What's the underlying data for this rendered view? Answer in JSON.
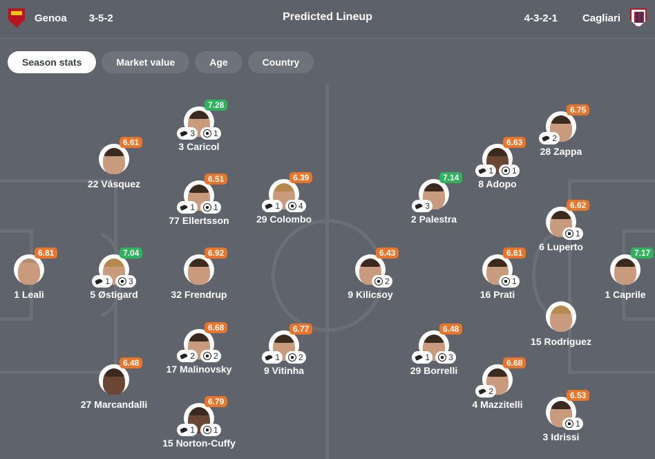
{
  "header": {
    "home": {
      "name": "Genoa",
      "formation": "3-5-2"
    },
    "title": "Predicted Lineup",
    "away": {
      "name": "Cagliari",
      "formation": "4-3-2-1"
    }
  },
  "tabs": [
    {
      "label": "Season stats",
      "active": true
    },
    {
      "label": "Market value",
      "active": false
    },
    {
      "label": "Age",
      "active": false
    },
    {
      "label": "Country",
      "active": false
    }
  ],
  "colors": {
    "rating_orange": "#e8752a",
    "rating_green": "#2fb35c",
    "pitch": "#5f646c",
    "line": "#6b7078"
  },
  "players": {
    "leali": {
      "name": "1 Leali",
      "rating": "6.81"
    },
    "vasquez": {
      "name": "22 Vásquez",
      "rating": "6.61"
    },
    "ostigard": {
      "name": "5 Østigard",
      "rating": "7.04",
      "assists": "1",
      "goals": "3"
    },
    "marcandalli": {
      "name": "27 Marcandalli",
      "rating": "6.48"
    },
    "caricol": {
      "name": "3 Caricol",
      "rating": "7.28",
      "assists": "3",
      "goals": "1"
    },
    "ellertsson": {
      "name": "77 Ellertsson",
      "rating": "6.51",
      "assists": "1",
      "goals": "1"
    },
    "frendrup": {
      "name": "32 Frendrup",
      "rating": "6.92"
    },
    "malinovsky": {
      "name": "17 Malinovsky",
      "rating": "6.68",
      "assists": "2",
      "goals": "2"
    },
    "nortoncuffy": {
      "name": "15 Norton-Cuffy",
      "rating": "6.79",
      "assists": "1",
      "goals": "1"
    },
    "colombo": {
      "name": "29 Colombo",
      "rating": "6.39",
      "assists": "1",
      "goals": "4"
    },
    "vitinha": {
      "name": "9 Vitinha",
      "rating": "6.77",
      "assists": "1",
      "goals": "2"
    },
    "kilicsoy": {
      "name": "9 Kilicsoy",
      "rating": "6.43",
      "goals": "2"
    },
    "palestra": {
      "name": "2 Palestra",
      "rating": "7.14",
      "assists": "3"
    },
    "borrelli": {
      "name": "29 Borrelli",
      "rating": "6.48",
      "assists": "1",
      "goals": "3"
    },
    "adopo": {
      "name": "8 Adopo",
      "rating": "6.63",
      "assists": "1",
      "goals": "1"
    },
    "prati": {
      "name": "16 Prati",
      "rating": "6.61",
      "goals": "1"
    },
    "mazzitelli": {
      "name": "4 Mazzitelli",
      "rating": "6.68",
      "assists": "2"
    },
    "zappa": {
      "name": "28 Zappa",
      "rating": "6.75",
      "assists": "2"
    },
    "luperto": {
      "name": "6 Luperto",
      "rating": "6.62",
      "goals": "1"
    },
    "rodriguez": {
      "name": "15 Rodriguez"
    },
    "idrissi": {
      "name": "3 Idrissi",
      "rating": "6.53",
      "goals": "1"
    },
    "caprile": {
      "name": "1 Caprile",
      "rating": "7.17"
    }
  }
}
